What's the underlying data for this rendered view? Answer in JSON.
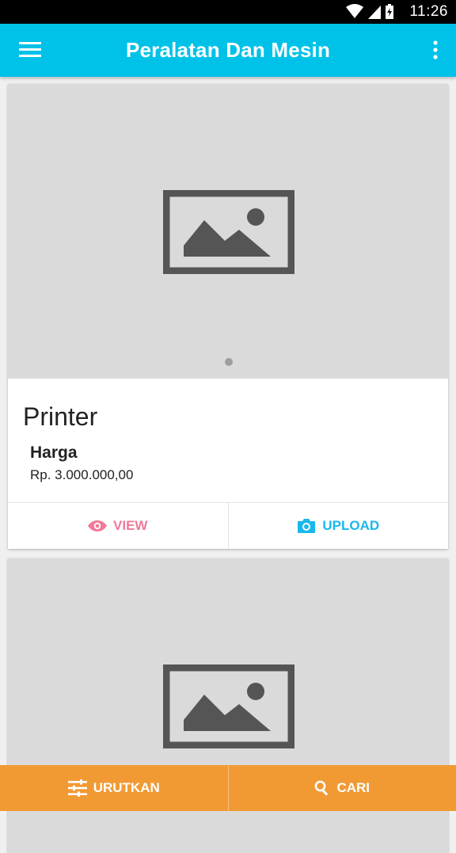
{
  "status_bar": {
    "time": "11:26"
  },
  "app_bar": {
    "title": "Peralatan Dan Mesin",
    "menu_icon": "hamburger-menu-icon",
    "overflow_icon": "more-vert-icon"
  },
  "items": [
    {
      "name": "Printer",
      "price_label": "Harga",
      "price_value": "Rp. 3.000.000,00",
      "view_label": "VIEW",
      "upload_label": "UPLOAD"
    },
    {
      "name": "",
      "price_label": "",
      "price_value": "",
      "view_label": "",
      "upload_label": ""
    }
  ],
  "bottom_bar": {
    "sort_label": "URUTKAN",
    "search_label": "CARI"
  },
  "colors": {
    "app_bar": "#00c2e8",
    "bottom_bar": "#f19a34",
    "view_accent": "#f07a98",
    "upload_accent": "#19b8ec",
    "media_bg": "#dadada"
  }
}
